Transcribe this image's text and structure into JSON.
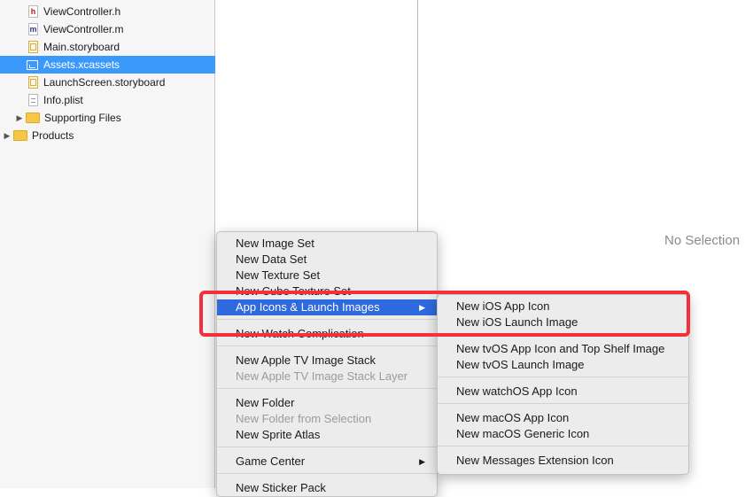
{
  "navigator": {
    "items": [
      {
        "label": "ViewController.h",
        "icon": "header-file-icon"
      },
      {
        "label": "ViewController.m",
        "icon": "objc-file-icon"
      },
      {
        "label": "Main.storyboard",
        "icon": "storyboard-file-icon"
      },
      {
        "label": "Assets.xcassets",
        "icon": "asset-catalog-icon",
        "selected": true
      },
      {
        "label": "LaunchScreen.storyboard",
        "icon": "storyboard-file-icon"
      },
      {
        "label": "Info.plist",
        "icon": "plist-file-icon"
      },
      {
        "label": "Supporting Files",
        "icon": "folder-icon"
      },
      {
        "label": "Products",
        "icon": "folder-icon"
      }
    ],
    "icon_glyphs": {
      "h": "h",
      "m": "m"
    }
  },
  "editor": {
    "no_selection": "No Selection"
  },
  "context_menu": {
    "items": [
      {
        "label": "New Image Set"
      },
      {
        "label": "New Data Set"
      },
      {
        "label": "New Texture Set"
      },
      {
        "label": "New Cube Texture Set"
      },
      {
        "label": "App Icons & Launch Images",
        "submenu": true,
        "highlighted": true
      },
      {
        "label": "New Watch Complication"
      },
      {
        "label": "New Apple TV Image Stack"
      },
      {
        "label": "New Apple TV Image Stack Layer",
        "disabled": true
      },
      {
        "label": "New Folder"
      },
      {
        "label": "New Folder from Selection",
        "disabled": true
      },
      {
        "label": "New Sprite Atlas"
      },
      {
        "label": "Game Center",
        "submenu": true
      },
      {
        "label": "New Sticker Pack"
      }
    ],
    "submenu_arrow": "▶"
  },
  "submenu": {
    "items": [
      {
        "label": "New iOS App Icon"
      },
      {
        "label": "New iOS Launch Image"
      },
      {
        "label": "New tvOS App Icon and Top Shelf Image"
      },
      {
        "label": "New tvOS Launch Image"
      },
      {
        "label": "New watchOS App Icon"
      },
      {
        "label": "New macOS App Icon"
      },
      {
        "label": "New macOS Generic Icon"
      },
      {
        "label": "New Messages Extension Icon"
      }
    ]
  },
  "colors": {
    "selection": "#3b99fc",
    "menu_highlight": "#2f69de",
    "annotation": "#f5303a"
  }
}
